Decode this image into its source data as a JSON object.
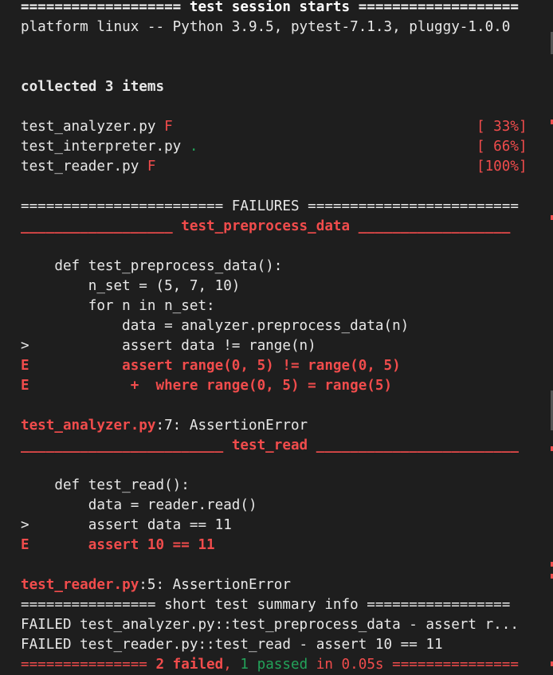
{
  "header_rule": "=================== test session starts ===================",
  "platform_line": "platform linux -- Python 3.9.5, pytest-7.1.3, pluggy-1.0.0",
  "collected_line": "collected 3 items",
  "results": [
    {
      "file": "test_analyzer.py",
      "mark": "F",
      "pct": "[ 33%]"
    },
    {
      "file": "test_interpreter.py",
      "mark": ".",
      "pct": "[ 66%]"
    },
    {
      "file": "test_reader.py",
      "mark": "F",
      "pct": "[100%]"
    }
  ],
  "failures_rule": "======================== FAILURES =========================",
  "failure1": {
    "header_left": "__________________ ",
    "header_name": "test_preprocess_data",
    "header_right": " __________________",
    "code": [
      "    def test_preprocess_data():",
      "        n_set = (5, 7, 10)",
      "        for n in n_set:",
      "            data = analyzer.preprocess_data(n)",
      ">           assert data != range(n)"
    ],
    "errors": [
      "E           assert range(0, 5) != range(0, 5)",
      "E            +  where range(0, 5) = range(5)"
    ],
    "location_file": "test_analyzer.py",
    "location_rest": ":7: AssertionError"
  },
  "failure2": {
    "header_left": "________________________ ",
    "header_name": "test_read",
    "header_right": " ________________________",
    "code": [
      "    def test_read():",
      "        data = reader.read()",
      ">       assert data == 11"
    ],
    "errors": [
      "E       assert 10 == 11"
    ],
    "location_file": "test_reader.py",
    "location_rest": ":5: AssertionError"
  },
  "summary_rule": "================ short test summary info =================",
  "summary_lines": [
    "FAILED test_analyzer.py::test_preprocess_data - assert r...",
    "FAILED test_reader.py::test_read - assert 10 == 11"
  ],
  "final": {
    "left": "=============== ",
    "failed": "2 failed",
    "comma": ", ",
    "passed": "1 passed",
    "time": " in 0.05s",
    "right": " ==============="
  },
  "colors": {
    "background": "#1e1e1e",
    "text": "#e8e8e8",
    "failure": "#f14c4c",
    "passed": "#23a35a"
  }
}
